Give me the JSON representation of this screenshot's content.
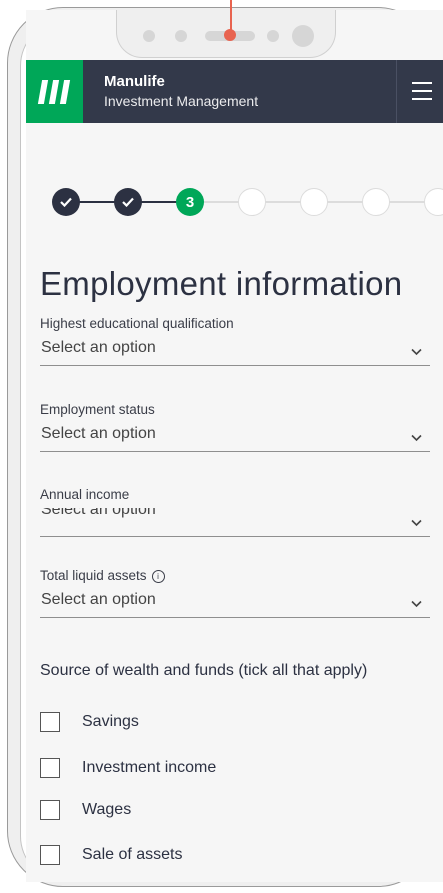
{
  "header": {
    "brand_name": "Manulife",
    "brand_sub": "Investment Management",
    "menu_icon": "hamburger-icon",
    "bg_color": "#33394a",
    "accent_color": "#00a758"
  },
  "stepper": {
    "current_step_label": "3",
    "total_steps": 7,
    "completed_steps": 2
  },
  "page": {
    "title": "Employment information"
  },
  "fields": [
    {
      "label": "Highest educational qualification",
      "value": "Select an option"
    },
    {
      "label": "Employment status",
      "value": "Select an option"
    },
    {
      "label": "Annual income",
      "value": "Select an option"
    },
    {
      "label": "Total liquid assets",
      "value": "Select an option",
      "info_icon": "info-icon"
    }
  ],
  "wealth_section": {
    "heading": "Source of wealth and funds (tick all that apply)",
    "options": [
      {
        "label": "Savings",
        "checked": false
      },
      {
        "label": "Investment income",
        "checked": false
      },
      {
        "label": "Wages",
        "checked": false
      },
      {
        "label": "Sale of assets",
        "checked": false
      }
    ]
  }
}
